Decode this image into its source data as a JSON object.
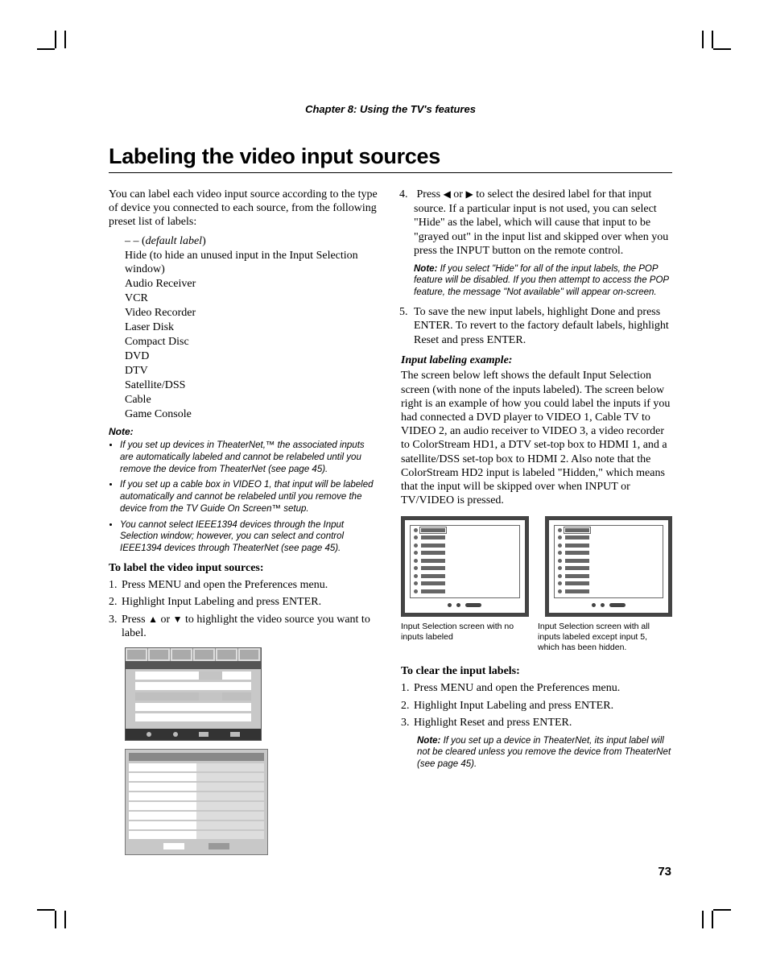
{
  "chapter": "Chapter 8: Using the TV's features",
  "title": "Labeling the video input sources",
  "intro": "You can label each video input source according to the type of device you connected to each source, from the following preset list of labels:",
  "labels": {
    "l0a": "– – (",
    "l0b": "default label",
    "l0c": ")",
    "l1": "Hide (to hide an unused input in the Input Selection window)",
    "l2": "Audio Receiver",
    "l3": "VCR",
    "l4": "Video Recorder",
    "l5": "Laser Disk",
    "l6": "Compact Disc",
    "l7": "DVD",
    "l8": "DTV",
    "l9": "Satellite/DSS",
    "l10": "Cable",
    "l11": "Game Console"
  },
  "noteHeading": "Note:",
  "noteBullets": {
    "b1": "If you set up devices in TheaterNet,™ the associated inputs are automatically labeled and cannot be relabeled until you remove the device from TheaterNet (see page 45).",
    "b2": "If you set up a cable box in VIDEO 1, that input will be labeled automatically and cannot be relabeled until you remove the device from the TV Guide On Screen™ setup.",
    "b3": "You cannot select IEEE1394 devices through the Input Selection window; however, you can select and control IEEE1394 devices through TheaterNet (see page 45)."
  },
  "toLabelHeading": "To label the video input sources:",
  "steps1": {
    "s1": "Press MENU and open the Preferences menu.",
    "s2": "Highlight Input Labeling and press ENTER.",
    "s3a": "Press ",
    "s3b": " or ",
    "s3c": " to highlight the video source you want to label."
  },
  "arrows": {
    "up": "▲",
    "down": "▼",
    "left": "◀",
    "right": "▶"
  },
  "steps2": {
    "s4a": "Press ",
    "s4b": " or ",
    "s4c": " to select the desired label for that input source. If a particular input is not used, you can select \"Hide\" as the label, which will cause that input to be \"grayed out\" in the input list and skipped over when you press the INPUT button on the remote control."
  },
  "note2": "If you select \"Hide\" for all of the input labels, the POP feature will be disabled. If you then attempt to access the POP feature, the message \"Not available\" will appear on-screen.",
  "step5": "To save the new input labels, highlight Done and press ENTER. To revert to the factory default labels, highlight Reset and press ENTER.",
  "exampleHeading": "Input labeling example:",
  "exampleBody": "The screen below left shows the default Input Selection screen (with none of the inputs labeled). The screen below right is an example of how you could label the inputs if you had connected a DVD player to VIDEO 1, Cable TV to VIDEO 2, an audio receiver to VIDEO 3, a video recorder to ColorStream HD1, a DTV set-top box to HDMI 1, and a satellite/DSS set-top box to HDMI 2. Also note that the ColorStream HD2 input is labeled \"Hidden,\" which means that the input will be skipped over when INPUT or TV/VIDEO is pressed.",
  "caption1": "Input Selection screen with no inputs labeled",
  "caption2": "Input Selection screen with all inputs labeled except input 5, which has been hidden.",
  "toClearHeading": "To clear the input labels:",
  "clearSteps": {
    "c1": "Press MENU and open the Preferences menu.",
    "c2": "Highlight Input Labeling and press ENTER.",
    "c3": "Highlight Reset and press ENTER."
  },
  "note3": "If you set up a device in TheaterNet, its input label will not be cleared unless you remove the device from TheaterNet (see page 45).",
  "noteWord": "Note:",
  "pageNumber": "73"
}
